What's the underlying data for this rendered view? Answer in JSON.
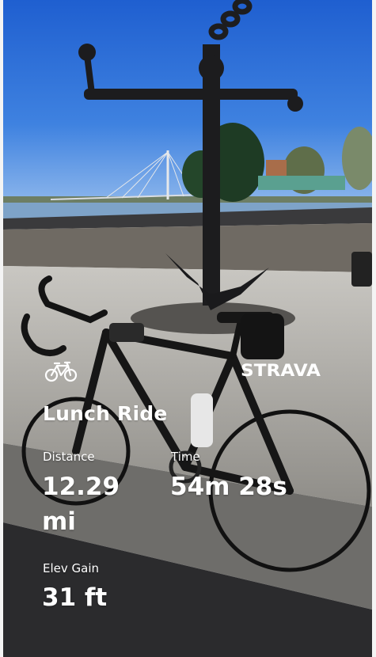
{
  "activity": {
    "title": "Lunch Ride",
    "app": "STRAVA",
    "type_icon": "bicycle-icon"
  },
  "stats": {
    "distance": {
      "label": "Distance",
      "value": "12.29 mi"
    },
    "time": {
      "label": "Time",
      "value": "54m 28s"
    },
    "elevation": {
      "label": "Elev Gain",
      "value": "31 ft"
    }
  },
  "colors": {
    "sky": "#2f6fd6",
    "text": "#ffffff",
    "ground": "#6f6a63",
    "pavement": "#9a9994",
    "road": "#2b2b2d"
  }
}
